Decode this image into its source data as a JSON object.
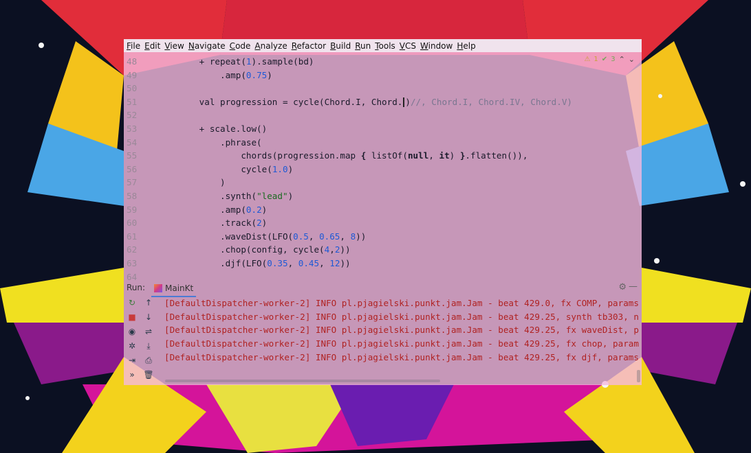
{
  "menu": [
    "File",
    "Edit",
    "View",
    "Navigate",
    "Code",
    "Analyze",
    "Refactor",
    "Build",
    "Run",
    "Tools",
    "VCS",
    "Window",
    "Help"
  ],
  "editor": {
    "inspections": {
      "warnings": "1",
      "ok": "3"
    },
    "lines": [
      {
        "n": "48",
        "segs": [
          [
            "kw",
            "        + repeat("
          ],
          [
            "num",
            "1"
          ],
          [
            "kw",
            ").sample(bd)"
          ]
        ]
      },
      {
        "n": "49",
        "segs": [
          [
            "kw",
            "            .amp("
          ],
          [
            "num",
            "0.75"
          ],
          [
            "kw",
            ")"
          ]
        ]
      },
      {
        "n": "50",
        "segs": []
      },
      {
        "n": "51",
        "segs": [
          [
            "kw",
            "        val progression = cycle(Chord.I, Chord."
          ],
          [
            "caret",
            ""
          ],
          [
            "kw",
            ")"
          ],
          [
            "cmt",
            "//, Chord.I, Chord.IV, Chord.V)"
          ]
        ]
      },
      {
        "n": "52",
        "segs": []
      },
      {
        "n": "53",
        "segs": [
          [
            "kw",
            "        + scale.low()"
          ]
        ]
      },
      {
        "n": "54",
        "segs": [
          [
            "kw",
            "            .phrase("
          ]
        ]
      },
      {
        "n": "55",
        "segs": [
          [
            "kw",
            "                chords(progression.map "
          ],
          [
            "bold",
            "{"
          ],
          [
            "kw",
            " listOf("
          ],
          [
            "bold",
            "null"
          ],
          [
            "kw",
            ", "
          ],
          [
            "bold",
            "it"
          ],
          [
            "kw",
            ") "
          ],
          [
            "bold",
            "}"
          ],
          [
            "kw",
            ".flatten()),"
          ]
        ]
      },
      {
        "n": "56",
        "segs": [
          [
            "kw",
            "                cycle("
          ],
          [
            "num",
            "1.0"
          ],
          [
            "kw",
            ")"
          ]
        ]
      },
      {
        "n": "57",
        "segs": [
          [
            "kw",
            "            )"
          ]
        ]
      },
      {
        "n": "58",
        "segs": [
          [
            "kw",
            "            .synth("
          ],
          [
            "str",
            "\"lead\""
          ],
          [
            "kw",
            ")"
          ]
        ]
      },
      {
        "n": "59",
        "segs": [
          [
            "kw",
            "            .amp("
          ],
          [
            "num",
            "0.2"
          ],
          [
            "kw",
            ")"
          ]
        ]
      },
      {
        "n": "60",
        "segs": [
          [
            "kw",
            "            .track("
          ],
          [
            "num",
            "2"
          ],
          [
            "kw",
            ")"
          ]
        ]
      },
      {
        "n": "61",
        "segs": [
          [
            "kw",
            "            .waveDist(LFO("
          ],
          [
            "num",
            "0.5"
          ],
          [
            "kw",
            ", "
          ],
          [
            "num",
            "0.65"
          ],
          [
            "kw",
            ", "
          ],
          [
            "num",
            "8"
          ],
          [
            "kw",
            "))"
          ]
        ]
      },
      {
        "n": "62",
        "segs": [
          [
            "kw",
            "            .chop(config, cycle("
          ],
          [
            "num",
            "4"
          ],
          [
            "kw",
            ","
          ],
          [
            "num",
            "2"
          ],
          [
            "kw",
            "))"
          ]
        ]
      },
      {
        "n": "63",
        "segs": [
          [
            "kw",
            "            .djf(LFO("
          ],
          [
            "num",
            "0.35"
          ],
          [
            "kw",
            ", "
          ],
          [
            "num",
            "0.45"
          ],
          [
            "kw",
            ", "
          ],
          [
            "num",
            "12"
          ],
          [
            "kw",
            "))"
          ]
        ]
      },
      {
        "n": "64",
        "segs": []
      }
    ]
  },
  "run": {
    "label": "Run:",
    "tab": "MainKt",
    "log": [
      "[DefaultDispatcher-worker-2] INFO pl.pjagielski.punkt.jam.Jam - beat 429.0, fx COMP, params",
      "[DefaultDispatcher-worker-2] INFO pl.pjagielski.punkt.jam.Jam - beat 429.25, synth tb303, n",
      "[DefaultDispatcher-worker-2] INFO pl.pjagielski.punkt.jam.Jam - beat 429.25, fx waveDist, p",
      "[DefaultDispatcher-worker-2] INFO pl.pjagielski.punkt.jam.Jam - beat 429.25, fx chop, param",
      "[DefaultDispatcher-worker-2] INFO pl.pjagielski.punkt.jam.Jam - beat 429.25, fx djf, params"
    ],
    "toolbar1": [
      {
        "name": "rerun-icon",
        "glyph": "↻"
      },
      {
        "name": "stop-icon",
        "glyph": "■"
      },
      {
        "name": "camera-icon",
        "glyph": "◉"
      },
      {
        "name": "debug-icon",
        "glyph": "✲"
      },
      {
        "name": "exit-icon",
        "glyph": "⇥"
      },
      {
        "name": "more-icon",
        "glyph": "»"
      }
    ],
    "toolbar2": [
      {
        "name": "scroll-up-icon",
        "glyph": "↑"
      },
      {
        "name": "scroll-down-icon",
        "glyph": "↓"
      },
      {
        "name": "soft-wrap-icon",
        "glyph": "⇌"
      },
      {
        "name": "scroll-to-end-icon",
        "glyph": "⤓"
      },
      {
        "name": "print-icon",
        "glyph": "⎙"
      },
      {
        "name": "trash-icon",
        "glyph": "🗑"
      }
    ]
  }
}
